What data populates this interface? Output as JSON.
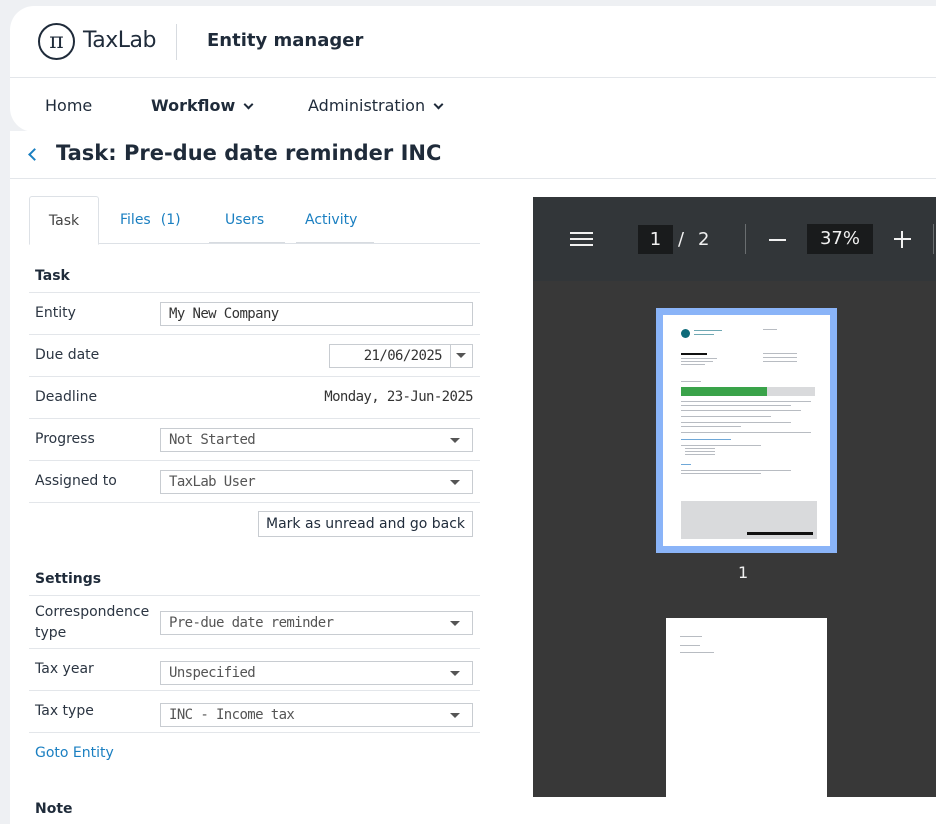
{
  "header": {
    "logo_glyph": "π",
    "brand": "TaxLab",
    "app_title": "Entity manager"
  },
  "nav": {
    "home": "Home",
    "workflow": "Workflow",
    "administration": "Administration"
  },
  "page": {
    "title": "Task: Pre-due date reminder INC"
  },
  "tabs": {
    "task": "Task",
    "files": "Files",
    "files_count": "(1)",
    "users": "Users",
    "activity": "Activity"
  },
  "task_section": {
    "title": "Task",
    "entity_label": "Entity",
    "entity_value": "My New Company",
    "due_date_label": "Due date",
    "due_date_value": "21/06/2025",
    "deadline_label": "Deadline",
    "deadline_value": "Monday, 23-Jun-2025",
    "progress_label": "Progress",
    "progress_value": "Not Started",
    "assigned_label": "Assigned to",
    "assigned_value": "TaxLab User",
    "mark_button": "Mark as unread and go back"
  },
  "settings_section": {
    "title": "Settings",
    "corr_type_label": "Correspondence type",
    "corr_type_value": "Pre-due date reminder",
    "tax_year_label": "Tax year",
    "tax_year_value": "Unspecified",
    "tax_type_label": "Tax type",
    "tax_type_value": "INC - Income tax",
    "goto_link": "Goto Entity"
  },
  "note_section": {
    "title": "Note"
  },
  "pdf_viewer": {
    "current_page": "1",
    "page_separator": "/",
    "total_pages": "2",
    "zoom": "37%",
    "thumbnail_1_label": "1",
    "accent_color": "#8ab4f8"
  }
}
